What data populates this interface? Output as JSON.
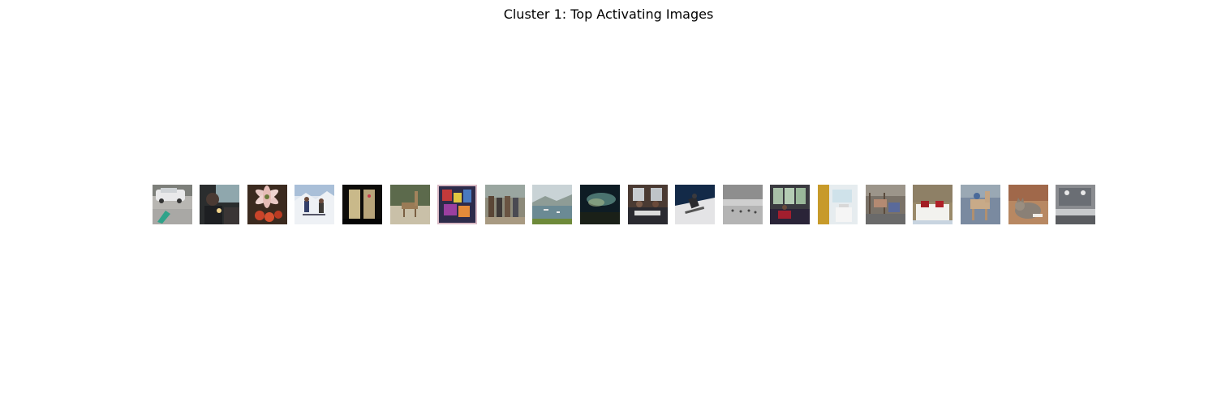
{
  "figure": {
    "title": "Cluster 1: Top Activating Images"
  },
  "thumbnails": [
    {
      "subject": "street scene with white SUV"
    },
    {
      "subject": "person with lit candle indoors"
    },
    {
      "subject": "lily flower and tomatoes"
    },
    {
      "subject": "skiers on snowy slope"
    },
    {
      "subject": "dark window"
    },
    {
      "subject": "giraffe on sand"
    },
    {
      "subject": "colorful collage poster"
    },
    {
      "subject": "group of people walking"
    },
    {
      "subject": "lake with boats and hills"
    },
    {
      "subject": "dark painting of sky"
    },
    {
      "subject": "people dining at table"
    },
    {
      "subject": "snowboarder on snow"
    },
    {
      "subject": "gray snowy field"
    },
    {
      "subject": "living room with windows"
    },
    {
      "subject": "bathroom interior"
    },
    {
      "subject": "animals in pen"
    },
    {
      "subject": "bed with red pillows"
    },
    {
      "subject": "horse statue"
    },
    {
      "subject": "cat lying down"
    },
    {
      "subject": "bathroom sinks and mirror"
    }
  ]
}
